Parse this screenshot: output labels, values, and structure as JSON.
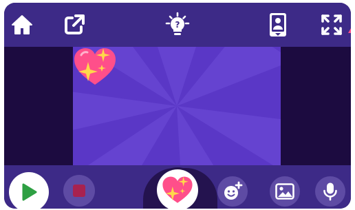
{
  "app": {
    "toolbar": {
      "home_icon": "home-icon",
      "share_icon": "share-icon",
      "hint_icon": "lightbulb-question-icon",
      "device_icon": "device-preview-icon",
      "fullscreen_icon": "fullscreen-icon"
    },
    "stage": {
      "background_color": "#5a37c6",
      "sprite_icon": "sparkling-heart-icon"
    },
    "controls": {
      "play_icon": "play-icon",
      "stop_icon": "stop-icon",
      "selected_character_icon": "sparkling-heart-icon",
      "add_character_icon": "add-character-icon",
      "background_icon": "image-icon",
      "record_icon": "microphone-icon"
    },
    "colors": {
      "toolbar": "#3d2a87",
      "play": "#2ea043",
      "stop": "#a8224f",
      "heart": "#ff4f8a",
      "sparkle": "#ffd84a"
    }
  }
}
